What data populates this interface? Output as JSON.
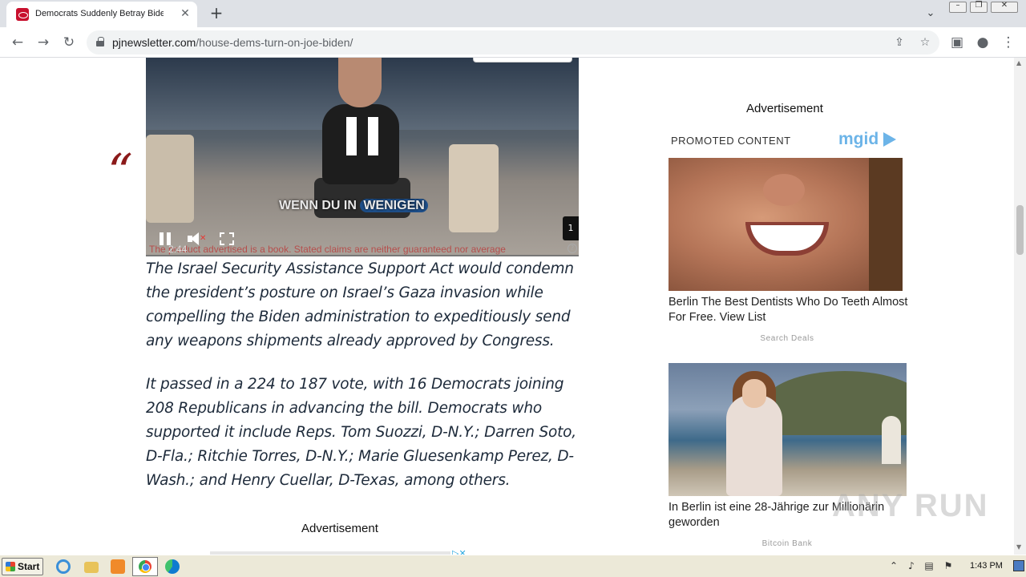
{
  "browser": {
    "tab_title": "Democrats Suddenly Betray Biden ov",
    "tab_close": "✕",
    "new_tab": "+",
    "url_domain": "pjnewsletter.com",
    "url_path": "/house-dems-turn-on-joe-biden/"
  },
  "video": {
    "caption_prefix": "WENN DU IN",
    "caption_highlight": "WENIGEN",
    "time": "2:44",
    "disclaimer": "The product advertised is a book. Stated claims are neither guaranteed nor average",
    "ad_index": "1",
    "help": "?"
  },
  "article": {
    "quote_mark": "“",
    "paragraphs": [
      "The Israel Security Assistance Support Act would condemn the president’s posture on Israel’s Gaza invasion while compelling the Biden administration to expeditiously send any weapons shipments already approved by Congress.",
      "It passed in a 224 to 187 vote, with 16 Democrats joining 208 Republicans in advancing the bill. Democrats who supported it include Reps. Tom Suozzi, D-N.Y.; Darren Soto, D-Fla.; Ritchie Torres, D-N.Y.; Marie Gluesenkamp Perez, D-Wash.; and Henry Cuellar, D-Texas, among others."
    ],
    "bottom_ad_label": "Advertisement"
  },
  "sidebar": {
    "ad_label": "Advertisement",
    "promoted": "PROMOTED CONTENT",
    "mgid": "mgid",
    "ads": [
      {
        "caption": "Berlin The Best Dentists Who Do Teeth Almost For Free. View List",
        "source": "Search Deals"
      },
      {
        "caption": "In Berlin ist eine 28-Jährige zur Millionärin geworden",
        "source": "Bitcoin Bank"
      }
    ]
  },
  "watermark": "ANY RUN",
  "taskbar": {
    "start": "Start",
    "clock": "1:43 PM"
  },
  "colors": {
    "quote": "#8b1a1a",
    "body_text": "#1d2a3a",
    "mgid": "#6cb4e8"
  }
}
